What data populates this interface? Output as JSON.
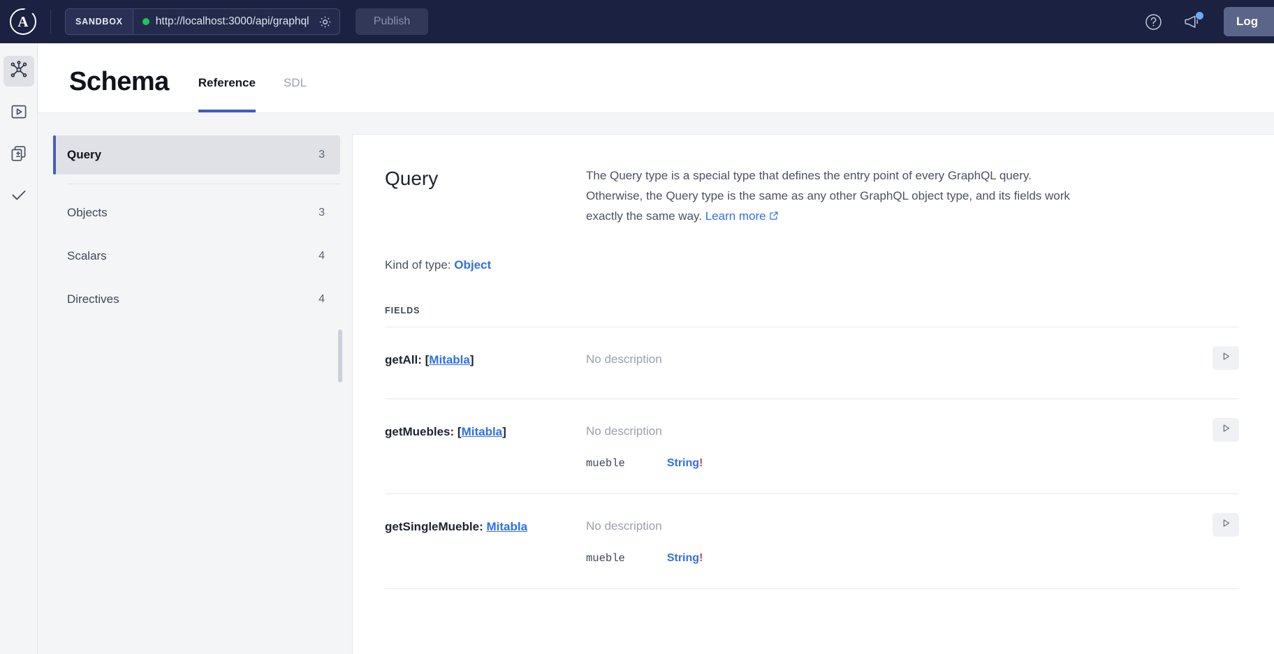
{
  "topbar": {
    "logo_letter": "A",
    "sandbox_label": "SANDBOX",
    "endpoint_url": "http://localhost:3000/api/graphql",
    "publish_label": "Publish",
    "login_label": "Log"
  },
  "rail": {
    "items": [
      {
        "icon": "schema-graph-icon",
        "name": "schema"
      },
      {
        "icon": "play-square-icon",
        "name": "explorer"
      },
      {
        "icon": "copy-pages-icon",
        "name": "variables"
      },
      {
        "icon": "check-icon",
        "name": "checks"
      }
    ]
  },
  "schema": {
    "title": "Schema",
    "tabs": [
      {
        "label": "Reference",
        "active": true
      },
      {
        "label": "SDL",
        "active": false
      }
    ],
    "nav": [
      {
        "label": "Query",
        "count": "3",
        "active": true
      },
      {
        "label": "Objects",
        "count": "3",
        "active": false
      },
      {
        "label": "Scalars",
        "count": "4",
        "active": false
      },
      {
        "label": "Directives",
        "count": "4",
        "active": false
      }
    ]
  },
  "content": {
    "type_name": "Query",
    "description": "The Query type is a special type that defines the entry point of every GraphQL query. Otherwise, the Query type is the same as any other GraphQL object type, and its fields work exactly the same way. ",
    "learn_more": "Learn more",
    "kind_label": "Kind of type: ",
    "kind_value": "Object",
    "fields_label": "FIELDS",
    "fields": [
      {
        "name": "getAll: ",
        "open_bracket": "[",
        "type": "Mitabla",
        "close_bracket": "]",
        "description": "No description",
        "args": []
      },
      {
        "name": "getMuebles: ",
        "open_bracket": "[",
        "type": "Mitabla",
        "close_bracket": "]",
        "description": "No description",
        "args": [
          {
            "arg_name": "mueble",
            "arg_type": "String",
            "required": "!"
          }
        ]
      },
      {
        "name": "getSingleMueble: ",
        "open_bracket": "",
        "type": "Mitabla",
        "close_bracket": "",
        "description": "No description",
        "args": [
          {
            "arg_name": "mueble",
            "arg_type": "String",
            "required": "!"
          }
        ]
      }
    ]
  },
  "colors": {
    "header_bg": "#1b2140",
    "accent_blue": "#2f6fed",
    "active_tab": "#3f5bc4",
    "status_green": "#21c35d",
    "required_red": "#d14343"
  }
}
